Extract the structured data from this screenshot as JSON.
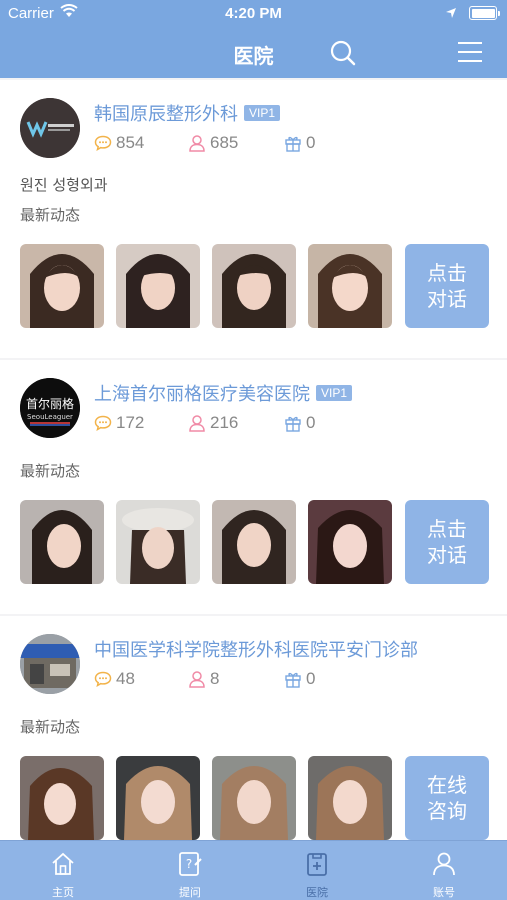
{
  "status": {
    "carrier": "Carrier",
    "time": "4:20 PM"
  },
  "nav": {
    "title": "医院",
    "search_icon": "search-icon",
    "menu_icon": "menu-icon"
  },
  "colors": {
    "brand": "#7aa7e0",
    "accent": "#6c9ad8",
    "button": "#8fb4e6",
    "tab_active": "#4a6fa8"
  },
  "hospitals": [
    {
      "name": "韩国原辰整形外科",
      "vip": "VIP1",
      "logo_text": "W",
      "comments": "854",
      "followers": "685",
      "gifts": "0",
      "desc": "원진 성형외과",
      "section": "最新动态",
      "cta": [
        "点击",
        "对话"
      ]
    },
    {
      "name": "上海首尔丽格医疗美容医院",
      "vip": "VIP1",
      "logo_text": "首尔丽格",
      "logo_sub": "SeouLeaguer",
      "comments": "172",
      "followers": "216",
      "gifts": "0",
      "section": "最新动态",
      "cta": [
        "点击",
        "对话"
      ]
    },
    {
      "name": "中国医学科学院整形外科医院平安门诊部",
      "comments": "48",
      "followers": "8",
      "gifts": "0",
      "section": "最新动态",
      "cta": [
        "在线",
        "咨询"
      ]
    }
  ],
  "tabs": [
    {
      "label": "主页",
      "icon": "home-icon"
    },
    {
      "label": "提问",
      "icon": "question-icon"
    },
    {
      "label": "医院",
      "icon": "hospital-icon",
      "active": true
    },
    {
      "label": "账号",
      "icon": "account-icon"
    }
  ]
}
